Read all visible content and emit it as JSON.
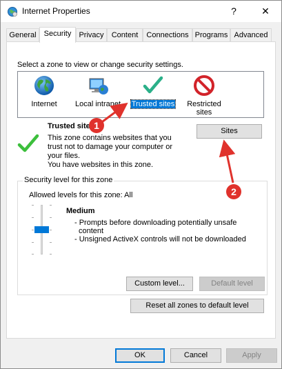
{
  "window": {
    "title": "Internet Properties",
    "help_glyph": "?",
    "close_glyph": "✕"
  },
  "tabs": [
    {
      "label": "General",
      "active": false
    },
    {
      "label": "Security",
      "active": true
    },
    {
      "label": "Privacy",
      "active": false
    },
    {
      "label": "Content",
      "active": false
    },
    {
      "label": "Connections",
      "active": false
    },
    {
      "label": "Programs",
      "active": false
    },
    {
      "label": "Advanced",
      "active": false
    }
  ],
  "security": {
    "instruction": "Select a zone to view or change security settings.",
    "zones": [
      {
        "label": "Internet",
        "icon": "globe-icon"
      },
      {
        "label": "Local intranet",
        "icon": "network-computer-icon"
      },
      {
        "label": "Trusted sites",
        "icon": "green-checkmark-icon",
        "selected": true
      },
      {
        "label": "Restricted sites",
        "line1": "Restricted",
        "line2": "sites",
        "icon": "no-entry-icon"
      }
    ],
    "zone_info": {
      "title": "Trusted sites",
      "desc_line1": "This zone contains websites that you",
      "desc_line2": "trust not to damage your computer or",
      "desc_line3": "your files.",
      "desc_line4": "You have websites in this zone."
    },
    "sites_button": "Sites",
    "level_group": {
      "legend": "Security level for this zone",
      "allowed": "Allowed levels for this zone: All",
      "level_name": "Medium",
      "bullet1_line1": "- Prompts before downloading potentially unsafe",
      "bullet1_line2": "content",
      "bullet2": "- Unsigned ActiveX controls will not be downloaded",
      "slider_level": 0.5,
      "custom_button": "Custom level...",
      "default_button": "Default level"
    },
    "reset_button": "Reset all zones to default level"
  },
  "footer": {
    "ok": "OK",
    "cancel": "Cancel",
    "apply": "Apply"
  },
  "annotations": [
    {
      "number": "1",
      "color": "#e0322c"
    },
    {
      "number": "2",
      "color": "#e0322c"
    }
  ]
}
